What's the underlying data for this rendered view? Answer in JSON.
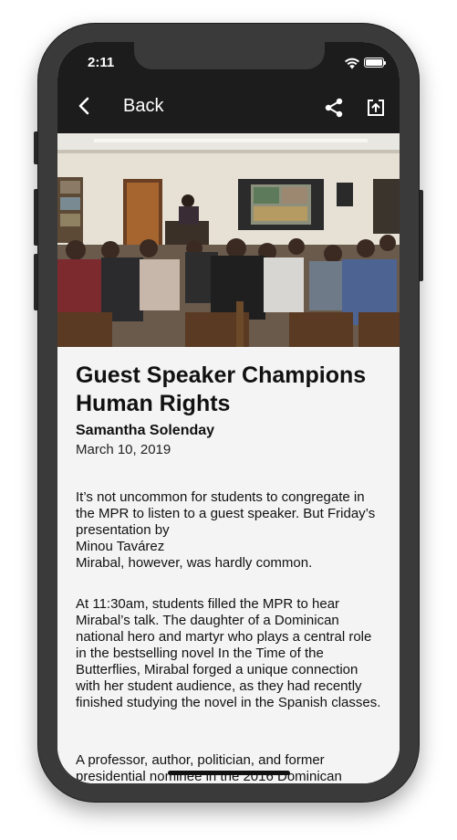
{
  "status_bar": {
    "time": "2:11"
  },
  "nav": {
    "back_label": "Back",
    "share_icon": "share-icon",
    "open_icon": "open-external-icon"
  },
  "article": {
    "image_alt": "Students seated in the MPR listening to a guest speaker at a podium",
    "title": "Guest Speaker Champions Human Rights",
    "author": "Samantha Solenday",
    "date": "March 10, 2019",
    "paragraphs": [
      "It’s not uncommon for students to congregate in the MPR to listen to a guest speaker. But Friday’s presentation by\nMinou  Tavárez\n Mirabal, however, was hardly common.",
      "At 11:30am, students filled the MPR to hear Mirabal’s talk. The daughter of a Dominican national hero and martyr who plays a central role in the bestselling novel In the Time of the Butterflies, Mirabal forged a unique connection with her student audience, as they had recently finished studying the novel in the Spanish classes.",
      "A professor, author, politician, and former presidential nominee in the 2016 Dominican"
    ]
  }
}
